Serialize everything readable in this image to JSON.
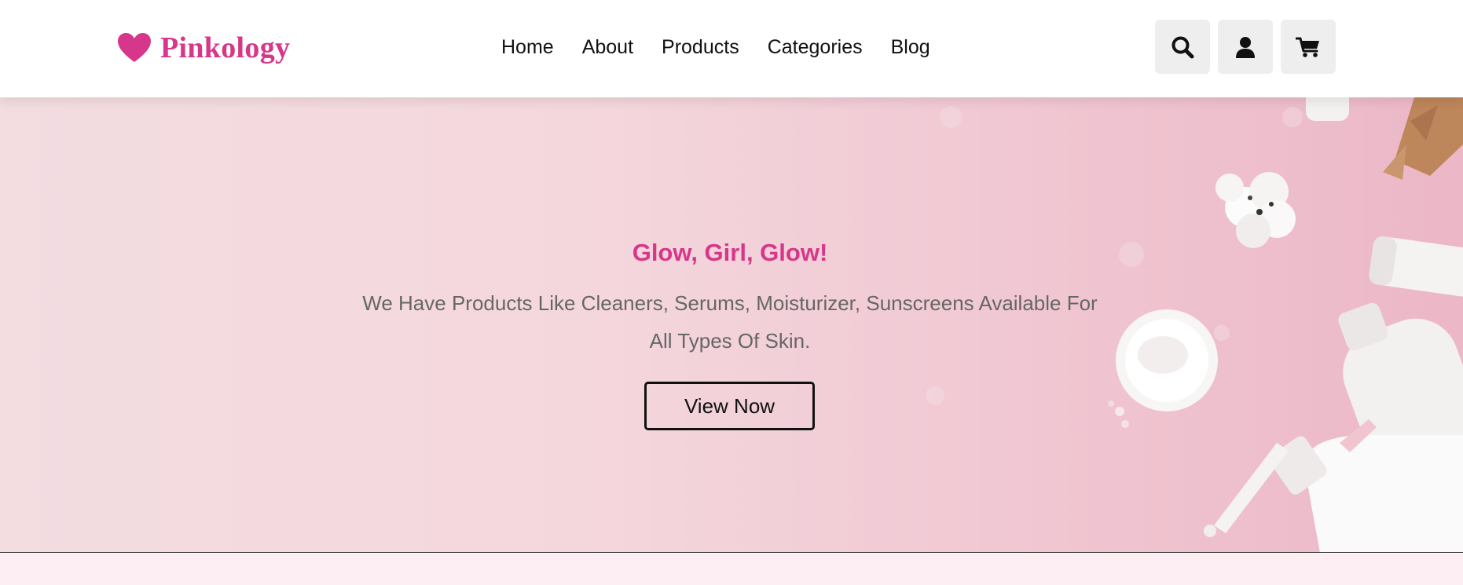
{
  "brand": {
    "name": "Pinkology",
    "icon": "heart-icon",
    "color": "#d6378a"
  },
  "nav": {
    "items": [
      {
        "label": "Home"
      },
      {
        "label": "About"
      },
      {
        "label": "Products"
      },
      {
        "label": "Categories"
      },
      {
        "label": "Blog"
      }
    ]
  },
  "actions": {
    "search_icon": "search-icon",
    "user_icon": "user-icon",
    "cart_icon": "cart-icon"
  },
  "hero": {
    "title": "Glow, Girl, Glow!",
    "description": "We Have Products Like Cleaners, Serums, Moisturizer, Sunscreens Available For All Types Of Skin.",
    "button_label": "View Now",
    "accent_color": "#d6378a"
  }
}
